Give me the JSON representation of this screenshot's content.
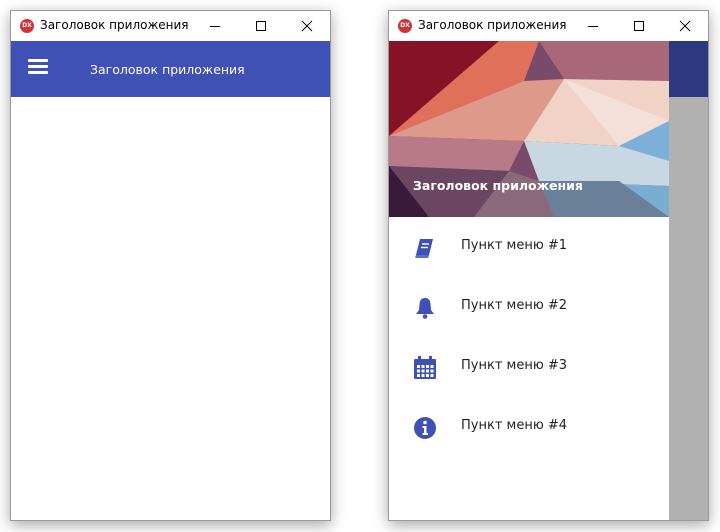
{
  "left_window": {
    "icon_text": "DX",
    "title": "Заголовок приложения",
    "appbar_title": "Заголовок приложения"
  },
  "right_window": {
    "icon_text": "DX",
    "title": "Заголовок приложения",
    "drawer": {
      "header_title": "Заголовок приложения",
      "items": [
        {
          "label": "Пункт меню #1",
          "icon": "book-icon"
        },
        {
          "label": "Пункт меню #2",
          "icon": "bell-icon"
        },
        {
          "label": "Пункт меню #3",
          "icon": "calendar-icon"
        },
        {
          "label": "Пункт меню #4",
          "icon": "info-icon"
        }
      ]
    }
  },
  "colors": {
    "accent": "#3f51b5",
    "accent_dimmed": "#2c3980",
    "scrim": "#b1b1b1",
    "app_icon": "#d13438"
  }
}
